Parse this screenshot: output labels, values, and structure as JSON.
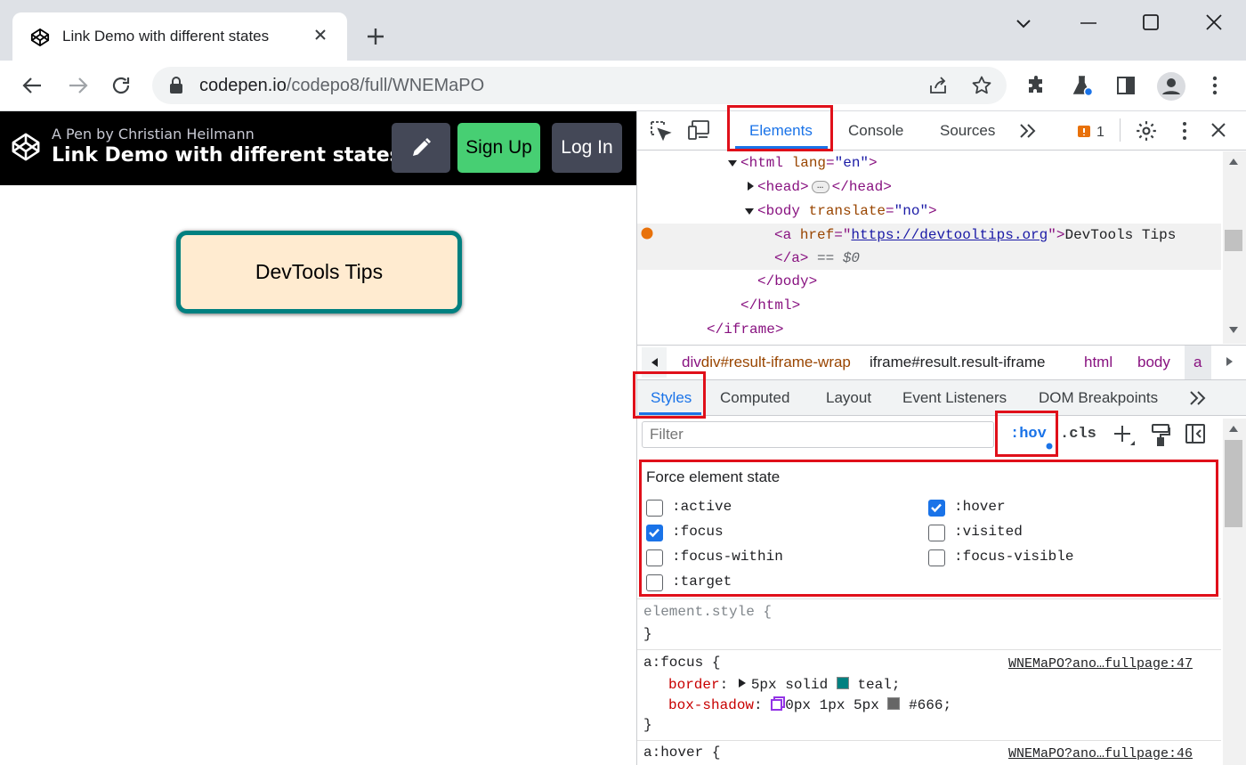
{
  "browser": {
    "tab_title": "Link Demo with different states",
    "url_host": "codepen.io",
    "url_path": "/codepo8/full/WNEMaPO"
  },
  "codepen": {
    "by_line": "A Pen by Christian Heilmann",
    "title": "Link Demo with different states",
    "signup_label": "Sign Up",
    "login_label": "Log In",
    "demo_link_text": "DevTools Tips"
  },
  "devtools": {
    "tabs": [
      "Elements",
      "Console",
      "Sources"
    ],
    "issues_count": "1",
    "tree": {
      "html_open": "<html ",
      "html_attr": "lang",
      "html_val": "\"en\"",
      "head": "<head>",
      "head_close": "</head>",
      "body_open": "<body ",
      "body_attr": "translate",
      "body_val": "\"no\"",
      "a_open": "<a ",
      "a_attr": "href",
      "a_href": "https://devtooltips.org",
      "a_text": "DevTools Tips",
      "a_close": "</a>",
      "dollar0": "== $0",
      "body_close": "</body>",
      "html_close": "</html>",
      "iframe_close": "</iframe>"
    },
    "breadcrumbs": [
      "div#result-iframe-wrap",
      "iframe#result.result-iframe",
      "html",
      "body",
      "a"
    ],
    "subtabs": [
      "Styles",
      "Computed",
      "Layout",
      "Event Listeners",
      "DOM Breakpoints"
    ],
    "filter_placeholder": "Filter",
    "hov_label": ":hov",
    "cls_label": ".cls",
    "force_state": {
      "heading": "Force element state",
      "left": [
        {
          "label": ":active",
          "checked": false
        },
        {
          "label": ":focus",
          "checked": true
        },
        {
          "label": ":focus-within",
          "checked": false
        },
        {
          "label": ":target",
          "checked": false
        }
      ],
      "right": [
        {
          "label": ":hover",
          "checked": true
        },
        {
          "label": ":visited",
          "checked": false
        },
        {
          "label": ":focus-visible",
          "checked": false
        }
      ]
    },
    "rules": {
      "element_style": "element.style {",
      "close_brace": "}",
      "focus_selector": "a:focus {",
      "focus_source": "WNEMaPO?ano…fullpage:47",
      "border_prop": "border",
      "border_value_a": "5px solid",
      "border_value_b": "teal;",
      "shadow_prop": "box-shadow",
      "shadow_value_a": "0px 1px 5px",
      "shadow_value_b": "#666;",
      "hover_selector": "a:hover {",
      "hover_source": "WNEMaPO?ano…fullpage:46"
    },
    "colors": {
      "teal": "#008080",
      "shadow": "#666666",
      "accent": "#1a73e8",
      "highlight": "#e0101a"
    }
  }
}
